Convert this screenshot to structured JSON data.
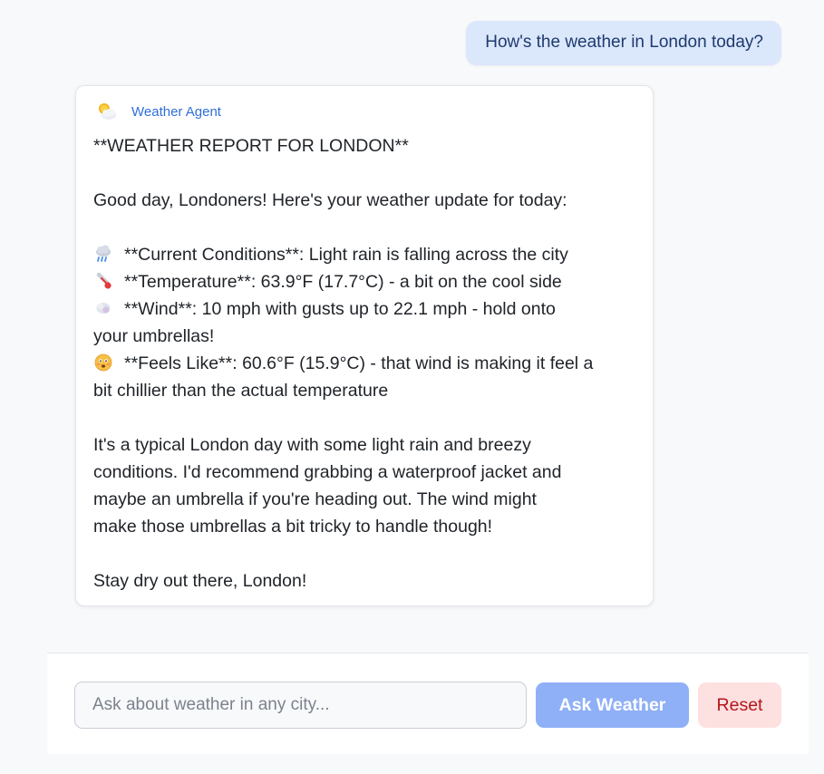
{
  "conversation": {
    "user_message": "How's the weather in London today?",
    "agent": {
      "name": "Weather Agent",
      "avatar_icon": "sun-behind-cloud-icon",
      "lines": {
        "heading": "**WEATHER REPORT FOR LONDON**",
        "greeting": "Good day, Londoners! Here's your weather update for today:",
        "conditions": "**Current Conditions**: Light rain is falling across the city",
        "temperature": "**Temperature**: 63.9°F (17.7°C) - a bit on the cool side",
        "wind_1": "**Wind**: 10 mph with gusts up to 22.1 mph - hold onto",
        "wind_2": "your umbrellas!",
        "feels_1": "**Feels Like**: 60.6°F (15.9°C) - that wind is making it feel a",
        "feels_2": "bit chillier than the actual temperature",
        "summary_1": "It's a typical London day with some light rain and breezy",
        "summary_2": "conditions. I'd recommend grabbing a waterproof jacket and",
        "summary_3": "maybe an umbrella if you're heading out. The wind might",
        "summary_4": "make those umbrellas a bit tricky to handle though!",
        "signoff": "Stay dry out there, London!"
      },
      "icons": {
        "conditions": "cloud-with-rain-icon",
        "temperature": "thermometer-icon",
        "wind": "wind-face-icon",
        "feels": "cold-face-icon"
      }
    }
  },
  "composer": {
    "placeholder": "Ask about weather in any city...",
    "value": "",
    "ask_label": "Ask Weather",
    "reset_label": "Reset"
  },
  "colors": {
    "background": "#f8f9fb",
    "user_bubble": "#dbe7fb",
    "agent_name": "#2f6fd6",
    "ask_button": "#8fb0f7",
    "reset_button_bg": "#fde0e0",
    "reset_button_text": "#b3161b"
  }
}
